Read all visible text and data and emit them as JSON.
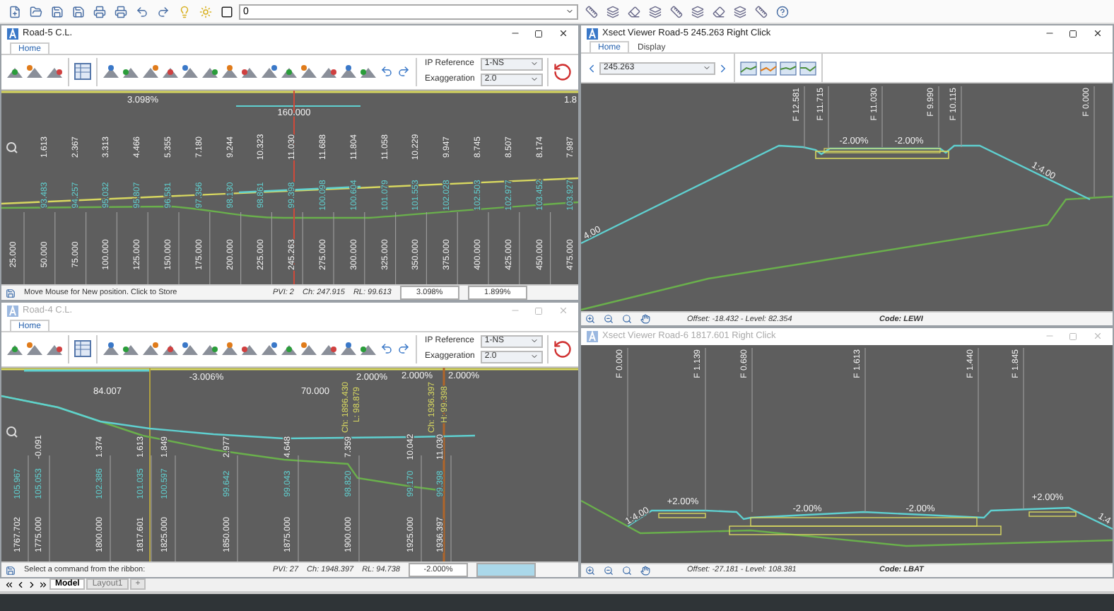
{
  "toolbar": {
    "layer": "0"
  },
  "profiles": [
    {
      "title": "Road-5 C.L.",
      "active": true,
      "tabs": [
        {
          "label": "Home",
          "selected": true
        }
      ],
      "fields": [
        {
          "label": "IP Reference",
          "value": "1-NS"
        },
        {
          "label": "Exaggeration",
          "value": "2.0"
        }
      ],
      "grades": [
        "3.098%",
        "1.8"
      ],
      "lengths": [
        "160.000"
      ],
      "stations": [
        {
          "chainage": "25.000"
        },
        {
          "chainage": "50.000",
          "depth": "1.613",
          "level": "93.483"
        },
        {
          "chainage": "75.000",
          "depth": "2.367",
          "level": "94.257"
        },
        {
          "chainage": "100.000",
          "depth": "3.313",
          "level": "95.032"
        },
        {
          "chainage": "125.000",
          "depth": "4.466",
          "level": "95.807"
        },
        {
          "chainage": "150.000",
          "depth": "5.355",
          "level": "96.581"
        },
        {
          "chainage": "175.000",
          "depth": "7.180",
          "level": "97.356"
        },
        {
          "chainage": "200.000",
          "depth": "9.244",
          "level": "98.130"
        },
        {
          "chainage": "225.000",
          "depth": "10.323",
          "level": "98.861"
        },
        {
          "chainage": "245.263",
          "depth": "11.030",
          "level": "99.398"
        },
        {
          "chainage": "275.000",
          "depth": "11.688",
          "level": "100.098"
        },
        {
          "chainage": "300.000",
          "depth": "11.804",
          "level": "100.604"
        },
        {
          "chainage": "325.000",
          "depth": "11.058",
          "level": "101.079"
        },
        {
          "chainage": "350.000",
          "depth": "10.229",
          "level": "101.553"
        },
        {
          "chainage": "375.000",
          "depth": "9.947",
          "level": "102.028"
        },
        {
          "chainage": "400.000",
          "depth": "8.745",
          "level": "102.503"
        },
        {
          "chainage": "425.000",
          "depth": "8.507",
          "level": "102.977"
        },
        {
          "chainage": "450.000",
          "depth": "8.174",
          "level": "103.452"
        },
        {
          "chainage": "475.000",
          "depth": "7.987",
          "level": "103.927"
        }
      ],
      "status": {
        "message": "Move Mouse for New position. Click to Store",
        "pvi": "PVI: 2",
        "ch": "Ch: 247.915",
        "rl": "RL: 99.613",
        "boxes": [
          {
            "value": "3.098%",
            "highlighted": false
          },
          {
            "value": "1.899%",
            "highlighted": false
          }
        ]
      }
    },
    {
      "title": "Road-4 C.L.",
      "active": false,
      "tabs": [
        {
          "label": "Home",
          "selected": true
        }
      ],
      "fields": [
        {
          "label": "IP Reference",
          "value": "1-NS"
        },
        {
          "label": "Exaggeration",
          "value": "2.0"
        }
      ],
      "grades": [
        "-3.006%",
        "2.000%",
        "2.000%",
        "2.000%"
      ],
      "lengths": [
        "84.007",
        "70.000"
      ],
      "annotations": [
        "Ch: 1896.430",
        "L: 98.879",
        "Ch: 1936.397",
        "H: 99.398"
      ],
      "stations": [
        {
          "chainage": "1767.702",
          "level": "105.967"
        },
        {
          "chainage": "1775.000",
          "depth": "-0.091",
          "level": "105.053"
        },
        {
          "chainage": "1800.000",
          "depth": "1.374",
          "level": "102.386"
        },
        {
          "chainage": "1817.601",
          "depth": "1.613",
          "level": "101.035"
        },
        {
          "chainage": "1825.000",
          "depth": "1.849",
          "level": "100.597"
        },
        {
          "chainage": "1850.000",
          "depth": "2.977",
          "level": "99.642"
        },
        {
          "chainage": "1875.000",
          "depth": "4.648",
          "level": "99.043"
        },
        {
          "chainage": "1900.000",
          "depth": "7.359",
          "level": "98.820"
        },
        {
          "chainage": "1925.000",
          "depth": "10.042",
          "level": "99.170"
        },
        {
          "chainage": "1936.397",
          "depth": "11.030",
          "level": "99.398"
        }
      ],
      "status": {
        "message": "Select a command from the ribbon:",
        "pvi": "PVI: 27",
        "ch": "Ch: 1948.397",
        "rl": "RL: 94.738",
        "boxes": [
          {
            "value": "-2.000%",
            "highlighted": false
          },
          {
            "highlighted": true
          }
        ]
      }
    }
  ],
  "xsects": [
    {
      "title": "Xsect Viewer Road-5  245.263  Right Click",
      "active": true,
      "tabs": [
        {
          "label": "Home",
          "selected": true
        },
        {
          "label": "Display",
          "selected": false
        }
      ],
      "chainage": "245.263",
      "offsets": [
        "F 12.581",
        "F 11.715",
        "F 11.030",
        "F 9.990",
        "F 10.115",
        "F 0.000"
      ],
      "grades": [
        "-2.00%",
        "-2.00%"
      ],
      "slopes": [
        "4.00",
        "1:4.00"
      ],
      "status": {
        "offset": "Offset: -18.432 - Level: 82.354",
        "code": "Code: LEWI"
      }
    },
    {
      "title": "Xsect Viewer Road-6  1817.601  Right Click",
      "active": false,
      "offsets": [
        "F 0.000",
        "F 1.139",
        "F 0.680",
        "F 1.613",
        "F 1.440",
        "F 1.845"
      ],
      "grades": [
        "+2.00%",
        "-2.00%",
        "-2.00%",
        "+2.00%"
      ],
      "slopes": [
        "1:4.00",
        "1:4"
      ],
      "status": {
        "offset": "Offset: -27.181 - Level: 108.381",
        "code": "Code: LBAT"
      }
    }
  ],
  "layout_tabs": [
    {
      "label": "Model",
      "selected": true
    },
    {
      "label": "Layout1",
      "selected": false
    },
    {
      "label": "+",
      "selected": false
    }
  ]
}
